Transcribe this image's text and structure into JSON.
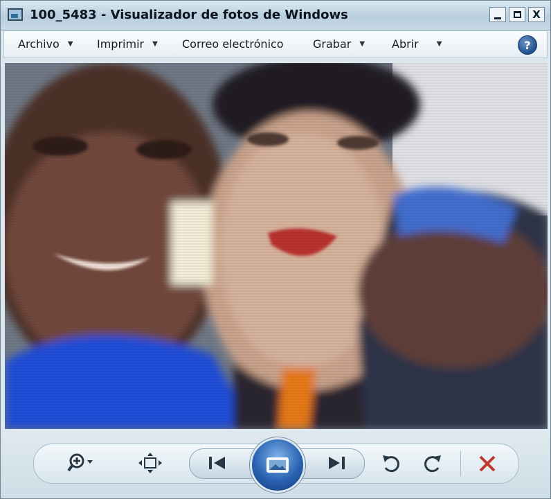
{
  "window": {
    "title": "100_5483 - Visualizador de fotos de Windows",
    "min_label": "",
    "max_label": "",
    "close_label": "X"
  },
  "menu": {
    "items": [
      {
        "label": "Archivo",
        "has_dropdown": true
      },
      {
        "label": "Imprimir",
        "has_dropdown": true
      },
      {
        "label": "Correo electrónico",
        "has_dropdown": false
      },
      {
        "label": "Grabar",
        "has_dropdown": true
      },
      {
        "label": "Abrir",
        "has_dropdown": true
      }
    ],
    "caret": "▼",
    "help_label": "?"
  },
  "controls": {
    "icons": [
      "zoom-icon",
      "fit-to-window-icon",
      "previous-icon",
      "slideshow-icon",
      "next-icon",
      "rotate-left-icon",
      "rotate-right-icon",
      "delete-icon"
    ],
    "colors": {
      "delete": "#c0392b",
      "slideshow": "#2a63b3"
    }
  }
}
